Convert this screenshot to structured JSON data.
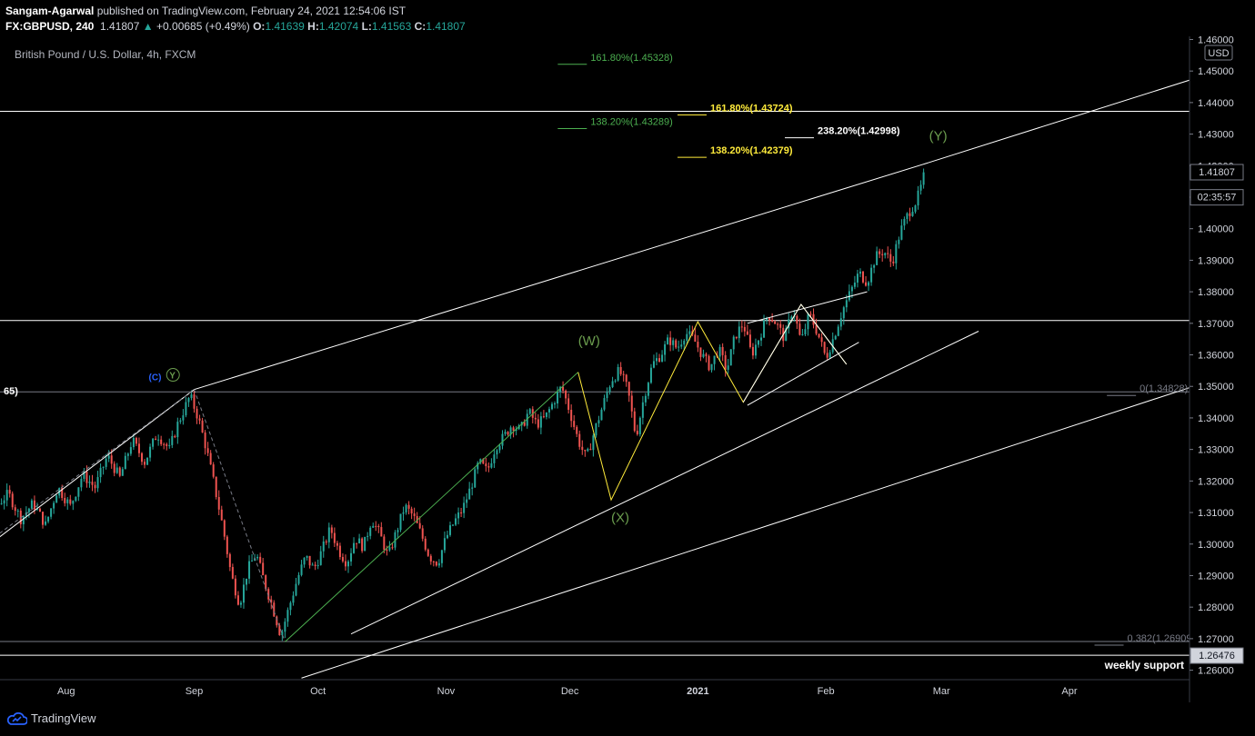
{
  "header": {
    "author": "Sangam-Agarwal",
    "published": "published on TradingView.com, February 24, 2021 12:54:06 IST",
    "symbol": "FX:GBPUSD, 240",
    "last": "1.41807",
    "change_arrow": "▲",
    "change": "+0.00685 (+0.49%)",
    "o_label": "O:",
    "o": "1.41639",
    "h_label": "H:",
    "h": "1.42074",
    "l_label": "L:",
    "l": "1.41563",
    "c_label": "C:",
    "c": "1.41807"
  },
  "instrument_title": "British Pound / U.S. Dollar, 4h, FXCM",
  "footer": {
    "brand": "TradingView"
  },
  "colors": {
    "up": "#26a69a",
    "down": "#ef5350",
    "yellow": "#ffeb3b",
    "fib_green": "#4caf50",
    "wave_green": "#6b9d4e",
    "blue": "#2962ff"
  },
  "chart_data": {
    "type": "candlestick",
    "title": "British Pound / U.S. Dollar, 4h, FXCM",
    "currency": "USD",
    "ylim": [
      1.257,
      1.461
    ],
    "y_ticks": [
      "1.26000",
      "1.27000",
      "1.28000",
      "1.29000",
      "1.30000",
      "1.31000",
      "1.32000",
      "1.33000",
      "1.34000",
      "1.35000",
      "1.36000",
      "1.37000",
      "1.38000",
      "1.39000",
      "1.40000",
      "1.41000",
      "1.42000",
      "1.43000",
      "1.44000",
      "1.45000",
      "1.46000"
    ],
    "x_ticks": [
      {
        "label": "Aug",
        "day": 31
      },
      {
        "label": "Sep",
        "day": 62
      },
      {
        "label": "Oct",
        "day": 92
      },
      {
        "label": "Nov",
        "day": 123
      },
      {
        "label": "Dec",
        "day": 153
      },
      {
        "label": "2021",
        "day": 184
      },
      {
        "label": "Feb",
        "day": 215
      },
      {
        "label": "Mar",
        "day": 243
      },
      {
        "label": "Apr",
        "day": 274
      }
    ],
    "x_day_range": [
      0,
      304
    ],
    "price_path": [
      [
        0,
        1.258
      ],
      [
        2,
        1.262
      ],
      [
        5,
        1.272
      ],
      [
        8,
        1.288
      ],
      [
        11,
        1.305
      ],
      [
        14,
        1.312
      ],
      [
        17,
        1.316
      ],
      [
        20,
        1.308
      ],
      [
        23,
        1.313
      ],
      [
        26,
        1.306
      ],
      [
        29,
        1.318
      ],
      [
        32,
        1.312
      ],
      [
        35,
        1.322
      ],
      [
        38,
        1.318
      ],
      [
        41,
        1.328
      ],
      [
        44,
        1.321
      ],
      [
        47,
        1.333
      ],
      [
        50,
        1.326
      ],
      [
        53,
        1.335
      ],
      [
        56,
        1.33
      ],
      [
        58,
        1.338
      ],
      [
        61,
        1.347
      ],
      [
        63,
        1.34
      ],
      [
        65,
        1.33
      ],
      [
        67,
        1.318
      ],
      [
        69,
        1.305
      ],
      [
        71,
        1.29
      ],
      [
        73,
        1.281
      ],
      [
        75,
        1.292
      ],
      [
        77,
        1.297
      ],
      [
        79,
        1.288
      ],
      [
        81,
        1.28
      ],
      [
        83,
        1.271
      ],
      [
        85,
        1.28
      ],
      [
        87,
        1.289
      ],
      [
        89,
        1.296
      ],
      [
        91,
        1.292
      ],
      [
        93,
        1.298
      ],
      [
        95,
        1.305
      ],
      [
        97,
        1.298
      ],
      [
        99,
        1.294
      ],
      [
        101,
        1.302
      ],
      [
        103,
        1.299
      ],
      [
        105,
        1.308
      ],
      [
        107,
        1.303
      ],
      [
        109,
        1.296
      ],
      [
        111,
        1.304
      ],
      [
        113,
        1.312
      ],
      [
        115,
        1.309
      ],
      [
        117,
        1.303
      ],
      [
        119,
        1.296
      ],
      [
        121,
        1.294
      ],
      [
        123,
        1.302
      ],
      [
        125,
        1.307
      ],
      [
        127,
        1.311
      ],
      [
        129,
        1.318
      ],
      [
        131,
        1.326
      ],
      [
        133,
        1.323
      ],
      [
        135,
        1.331
      ],
      [
        137,
        1.334
      ],
      [
        139,
        1.338
      ],
      [
        141,
        1.336
      ],
      [
        143,
        1.342
      ],
      [
        145,
        1.338
      ],
      [
        147,
        1.34
      ],
      [
        149,
        1.345
      ],
      [
        151,
        1.35
      ],
      [
        153,
        1.342
      ],
      [
        155,
        1.333
      ],
      [
        157,
        1.327
      ],
      [
        159,
        1.336
      ],
      [
        161,
        1.344
      ],
      [
        163,
        1.352
      ],
      [
        165,
        1.355
      ],
      [
        167,
        1.349
      ],
      [
        169,
        1.334
      ],
      [
        171,
        1.347
      ],
      [
        173,
        1.357
      ],
      [
        175,
        1.36
      ],
      [
        177,
        1.365
      ],
      [
        179,
        1.362
      ],
      [
        181,
        1.367
      ],
      [
        183,
        1.365
      ],
      [
        185,
        1.36
      ],
      [
        187,
        1.356
      ],
      [
        189,
        1.362
      ],
      [
        191,
        1.355
      ],
      [
        193,
        1.366
      ],
      [
        195,
        1.37
      ],
      [
        197,
        1.36
      ],
      [
        199,
        1.366
      ],
      [
        201,
        1.373
      ],
      [
        203,
        1.37
      ],
      [
        205,
        1.365
      ],
      [
        207,
        1.375
      ],
      [
        209,
        1.364
      ],
      [
        211,
        1.373
      ],
      [
        213,
        1.367
      ],
      [
        215,
        1.359
      ],
      [
        217,
        1.366
      ],
      [
        219,
        1.374
      ],
      [
        221,
        1.38
      ],
      [
        223,
        1.386
      ],
      [
        225,
        1.383
      ],
      [
        227,
        1.391
      ],
      [
        229,
        1.393
      ],
      [
        231,
        1.389
      ],
      [
        233,
        1.399
      ],
      [
        235,
        1.405
      ],
      [
        237,
        1.409
      ],
      [
        238,
        1.413
      ],
      [
        239,
        1.418
      ]
    ],
    "horizontal_lines": [
      {
        "price": 1.43724,
        "color": "#ffffff"
      },
      {
        "price": 1.37088,
        "color": "#ffffff"
      },
      {
        "price": 1.34828,
        "color": "#787b86"
      },
      {
        "price": 1.26909,
        "color": "#787b86"
      },
      {
        "price": 1.26476,
        "color": "#ffffff"
      }
    ],
    "trend_lines": [
      {
        "points": [
          [
            0,
            1.2875
          ],
          [
            62,
            1.349
          ],
          [
            240,
            1.421
          ],
          [
            304,
            1.4475
          ]
        ],
        "color": "#ffffff"
      },
      {
        "points": [
          [
            88,
            1.2575
          ],
          [
            304,
            1.35
          ]
        ],
        "color": "#ffffff"
      },
      {
        "points": [
          [
            100,
            1.2715
          ],
          [
            252,
            1.3675
          ]
        ],
        "color": "#ffffff"
      },
      {
        "points": [
          [
            196,
            1.344
          ],
          [
            223,
            1.364
          ]
        ],
        "color": "#ffffff"
      },
      {
        "points": [
          [
            196,
            1.37
          ],
          [
            225,
            1.38
          ]
        ],
        "color": "#ffffff"
      }
    ],
    "wave_paths": [
      {
        "points": [
          [
            0,
            1.289
          ],
          [
            62,
            1.349
          ]
        ],
        "color": "#787b86",
        "dashed": true
      },
      {
        "points": [
          [
            62,
            1.349
          ],
          [
            84,
            1.269
          ]
        ],
        "color": "#787b86",
        "dashed": true
      },
      {
        "points": [
          [
            84,
            1.269
          ],
          [
            155,
            1.3545
          ]
        ],
        "color": "#4caf50",
        "dashed": false
      },
      {
        "points": [
          [
            155,
            1.3545
          ],
          [
            163,
            1.314
          ],
          [
            184,
            1.3705
          ],
          [
            195,
            1.345
          ],
          [
            209,
            1.376
          ],
          [
            220,
            1.357
          ]
        ],
        "color": "#ffeb3b",
        "dashed": false
      },
      {
        "points": [
          [
            195,
            1.345
          ],
          [
            209,
            1.376
          ],
          [
            220,
            1.357
          ]
        ],
        "color": "#ffffff",
        "dashed": false
      }
    ],
    "fib_labels": [
      {
        "text": "161.80%(1.45328)",
        "price": 1.45328,
        "day": 158,
        "color": "#4caf50"
      },
      {
        "text": "138.20%(1.43289)",
        "price": 1.43289,
        "day": 158,
        "color": "#4caf50"
      },
      {
        "text": "161.80%(1.43724)",
        "price": 1.43724,
        "day": 187,
        "color": "#ffeb3b"
      },
      {
        "text": "138.20%(1.42379)",
        "price": 1.42379,
        "day": 187,
        "color": "#ffeb3b"
      },
      {
        "text": "238.20%(1.42998)",
        "price": 1.42998,
        "day": 213,
        "color": "#ffffff"
      },
      {
        "text": "0(1.34828)",
        "price": 1.34828,
        "day": 291,
        "color": "#787b86"
      },
      {
        "text": "0.382(1.26909)",
        "price": 1.26909,
        "day": 288,
        "color": "#787b86"
      }
    ],
    "wave_labels": [
      {
        "text": "(W)",
        "day": 155,
        "price": 1.363,
        "color": "#6b9d4e"
      },
      {
        "text": "(X)",
        "day": 163,
        "price": 1.307,
        "color": "#6b9d4e"
      },
      {
        "text": "(Y)",
        "day": 240,
        "price": 1.428,
        "color": "#6b9d4e"
      },
      {
        "text": "(C)",
        "day": 51,
        "price": 1.352,
        "color": "#2962ff"
      },
      {
        "text": "Y",
        "day": 56,
        "price": 1.3525,
        "color": "#6b9d4e"
      }
    ],
    "annotations": [
      {
        "text": "weekly support",
        "price": 1.2605
      },
      {
        "text": "65)",
        "price": 1.3475
      }
    ],
    "price_badges": [
      {
        "text": "1.41807",
        "price": 1.41807,
        "style": "current"
      },
      {
        "text": "02:35:57",
        "price": 1.4101,
        "style": "timer"
      },
      {
        "text": "1.26476",
        "price": 1.26476,
        "style": "level"
      }
    ]
  }
}
